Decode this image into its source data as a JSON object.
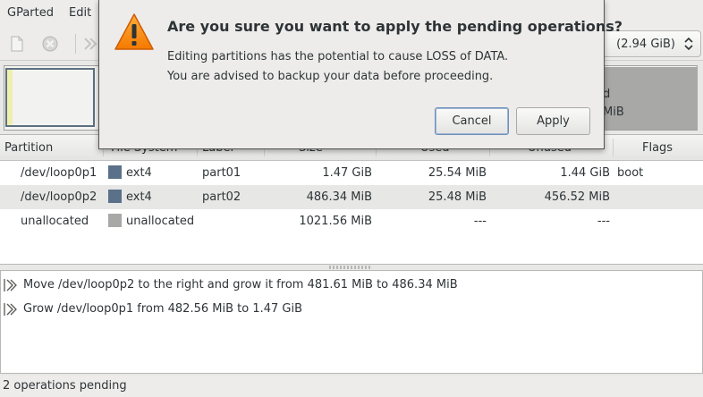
{
  "menubar": {
    "items": [
      "GParted",
      "Edit"
    ]
  },
  "toolbar": {
    "device_label": "(2.94 GiB)",
    "icons": [
      "new-icon",
      "delete-icon",
      "forward-icon"
    ]
  },
  "graphic": {
    "unallocated_line1": "d",
    "unallocated_line2": "MiB"
  },
  "table": {
    "headers": [
      "Partition",
      "File System",
      "Label",
      "Size",
      "Used",
      "Unused",
      "Flags"
    ],
    "rows": [
      {
        "partition": "/dev/loop0p1",
        "fs": "ext4",
        "label": "part01",
        "size": "1.47 GiB",
        "used": "25.54 MiB",
        "unused": "1.44 GiB",
        "flags": "boot"
      },
      {
        "partition": "/dev/loop0p2",
        "fs": "ext4",
        "label": "part02",
        "size": "486.34 MiB",
        "used": "25.48 MiB",
        "unused": "456.52 MiB",
        "flags": ""
      },
      {
        "partition": "unallocated",
        "fs": "unallocated",
        "label": "",
        "size": "1021.56 MiB",
        "used": "---",
        "unused": "---",
        "flags": ""
      }
    ],
    "colors": {
      "ext4": "#5b7089",
      "unallocated": "#a8a8a6"
    }
  },
  "operations": [
    "Move /dev/loop0p2 to the right and grow it from 481.61 MiB to 486.34 MiB",
    "Grow /dev/loop0p1 from 482.56 MiB to 1.47 GiB"
  ],
  "status": "2 operations pending",
  "dialog": {
    "title": "Are you sure you want to apply the pending operations?",
    "line1": "Editing partitions has the potential to cause LOSS of DATA.",
    "line2": "You are advised to backup your data before proceeding.",
    "cancel_label": "Cancel",
    "apply_label": "Apply"
  }
}
